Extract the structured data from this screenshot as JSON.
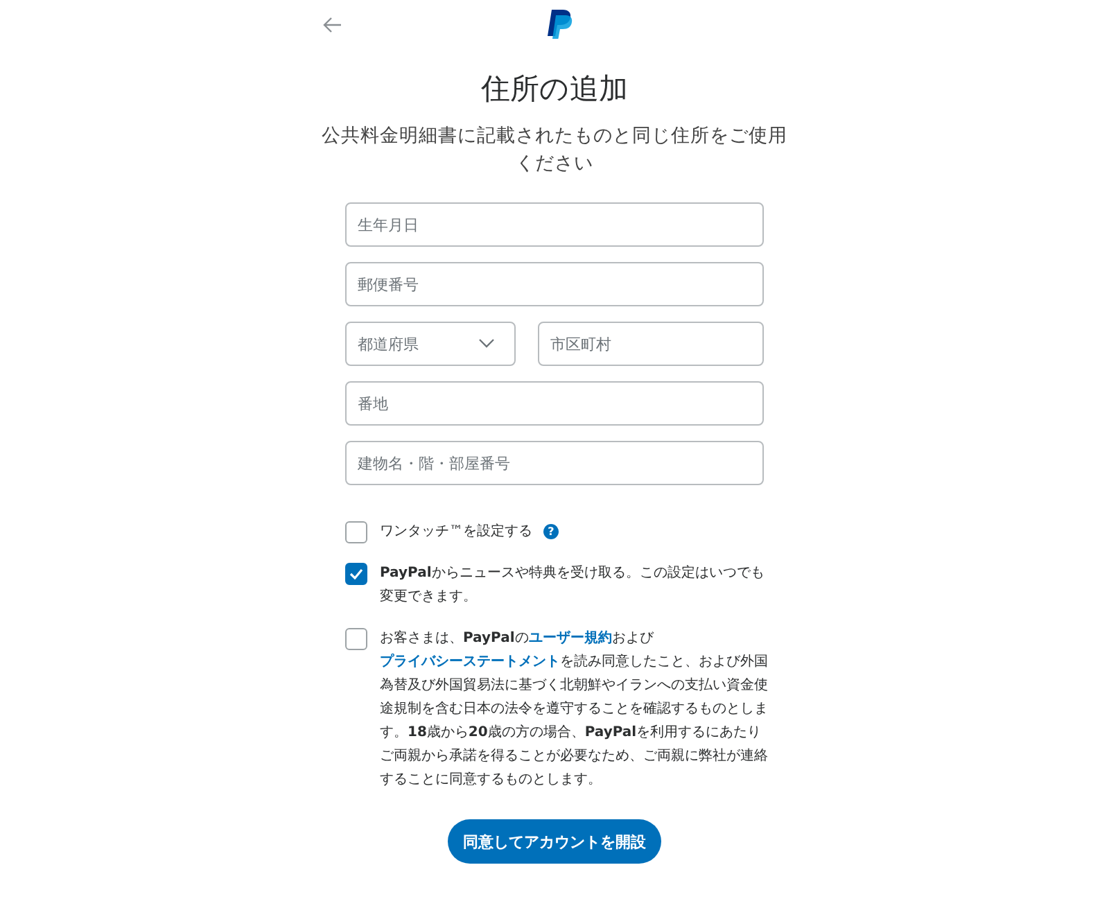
{
  "title": "住所の追加",
  "subtitle": "公共料金明細書に記載されたものと同じ住所をご使用ください",
  "field_rows": [
    {
      "fields": [
        {
          "kind": "text",
          "placeholder": "生年月日"
        }
      ]
    },
    {
      "fields": [
        {
          "kind": "text",
          "placeholder": "郵便番号"
        }
      ]
    },
    {
      "fields": [
        {
          "kind": "select",
          "placeholder": "都道府県"
        },
        {
          "kind": "text",
          "placeholder": "市区町村"
        }
      ]
    },
    {
      "fields": [
        {
          "kind": "text",
          "placeholder": "番地"
        }
      ]
    },
    {
      "fields": [
        {
          "kind": "text",
          "placeholder": "建物名・階・部屋番号"
        }
      ]
    }
  ],
  "checkboxes": [
    {
      "checked": false,
      "help": "?",
      "segments": [
        {
          "kind": "plain",
          "text": "ワンタッチ™を設定する"
        }
      ]
    },
    {
      "checked": true,
      "segments": [
        {
          "kind": "bold",
          "text": "PayPal"
        },
        {
          "kind": "plain",
          "text": "からニュースや特典を受け取る。この設定はいつでも変更できます。"
        }
      ]
    },
    {
      "checked": false,
      "segments": [
        {
          "kind": "plain",
          "text": "お客さまは、"
        },
        {
          "kind": "bold",
          "text": "PayPal"
        },
        {
          "kind": "plain",
          "text": "の"
        },
        {
          "kind": "link",
          "text": "ユーザー規約"
        },
        {
          "kind": "plain",
          "text": "および"
        },
        {
          "kind": "link",
          "text": "プライバシーステートメント"
        },
        {
          "kind": "plain",
          "text": "を読み同意したこと、および外国為替及び外国貿易法に基づく北朝鮮やイランへの支払い資金使途規制を含む日本の法令を遵守することを確認するものとします。"
        },
        {
          "kind": "bold",
          "text": "18"
        },
        {
          "kind": "plain",
          "text": "歳から"
        },
        {
          "kind": "bold",
          "text": "20"
        },
        {
          "kind": "plain",
          "text": "歳の方の場合、"
        },
        {
          "kind": "bold",
          "text": "PayPal"
        },
        {
          "kind": "plain",
          "text": "を利用するにあたりご両親から承諾を得ることが必要なため、ご両親に弊社が連絡することに同意するものとします。"
        }
      ]
    }
  ],
  "submit": "同意してアカウントを開設"
}
